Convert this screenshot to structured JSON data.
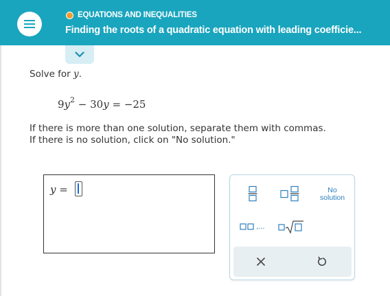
{
  "header": {
    "topic": "EQUATIONS AND INEQUALITIES",
    "title": "Finding the roots of a quadratic equation with leading coefficie...",
    "menu_icon": "hamburger-icon",
    "collapse_icon": "chevron-down-icon",
    "background_color": "#1aa5be",
    "topic_dot_color": "#f49b2b"
  },
  "problem": {
    "prompt_text": "Solve for ",
    "prompt_var": "y",
    "prompt_end": ".",
    "equation": {
      "coef_a": "9",
      "var": "y",
      "exponent": "2",
      "minus": " − ",
      "coef_b": "30",
      "equals": " = −25"
    },
    "instruction_line1": "If there is more than one solution, separate them with commas.",
    "instruction_line2": "If there is no solution, click on \"No solution.\""
  },
  "answer": {
    "var": "y",
    "equals": " = "
  },
  "keypad": {
    "no_solution_line1": "No",
    "no_solution_line2": "solution",
    "list_dots": ",...",
    "fraction_icon": "fraction-icon",
    "mixed_number_icon": "mixed-number-icon",
    "list_icon": "list-icon",
    "nth_root_icon": "nth-root-icon",
    "clear_icon": "clear-x-icon",
    "undo_icon": "undo-icon",
    "accent_color": "#2b7fbf"
  }
}
